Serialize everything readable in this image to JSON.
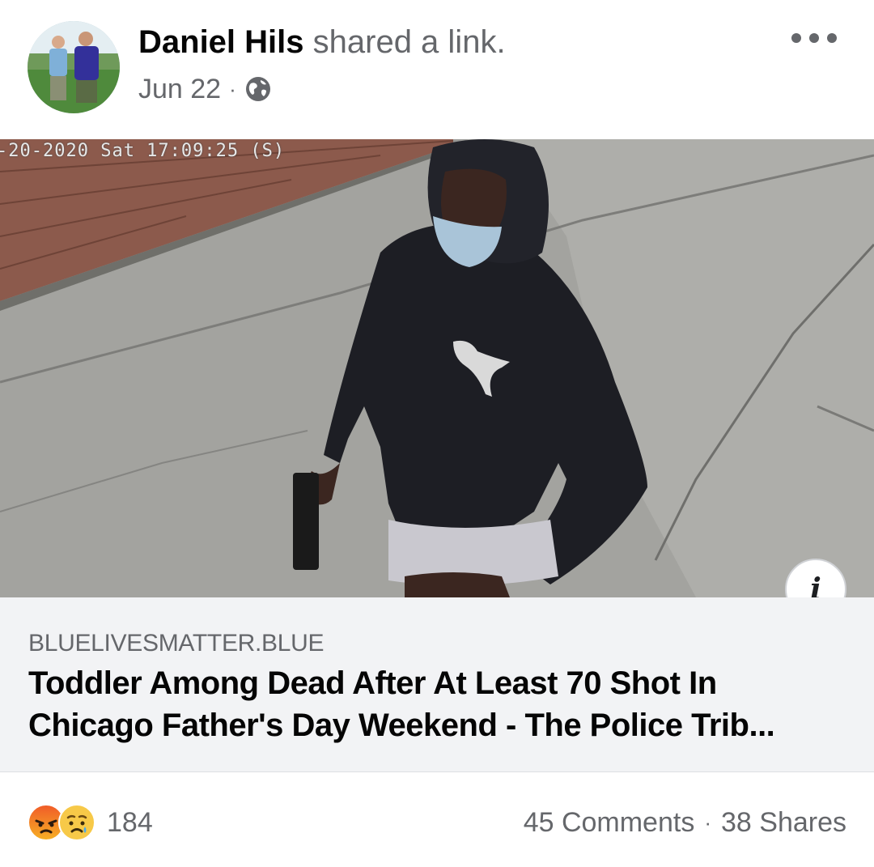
{
  "post": {
    "author": "Daniel Hils",
    "action": "shared a link.",
    "date": "Jun 22",
    "separator": "·",
    "privacy_icon": "globe-icon",
    "more_icon": "more-options-icon"
  },
  "media": {
    "timestamp_overlay": "-20-2020 Sat 17:09:25 (S)",
    "shirt_text": "PUMA",
    "info_icon": "i"
  },
  "link": {
    "domain": "BLUELIVESMATTER.BLUE",
    "title": "Toddler Among Dead After At Least 70 Shot In Chicago Father's Day Weekend - The Police Trib..."
  },
  "footer": {
    "reaction_icons": [
      "angry-reaction-icon",
      "sad-reaction-icon"
    ],
    "reaction_count": "184",
    "comments": "45 Comments",
    "separator": "·",
    "shares": "38 Shares"
  },
  "colors": {
    "secondary_text": "#65676b",
    "preview_bg": "#f2f3f5",
    "angry": "#e9710f",
    "sad": "#f7b125"
  }
}
